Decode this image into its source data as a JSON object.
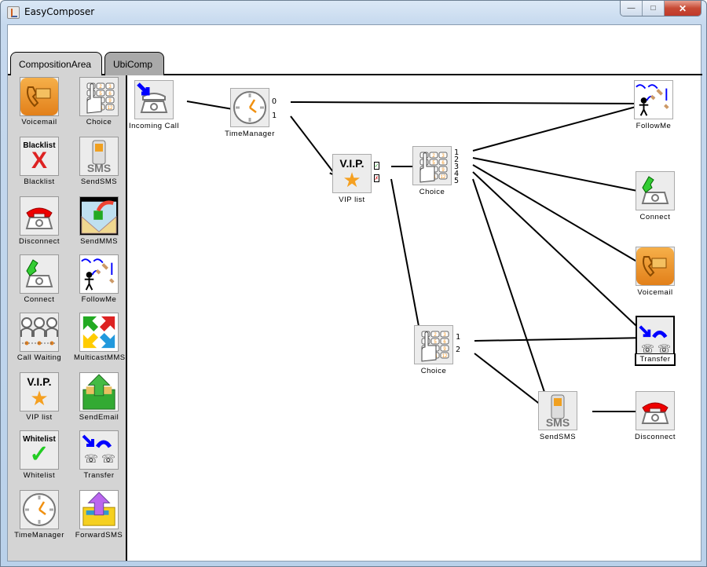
{
  "window": {
    "title": "EasyComposer",
    "controls": {
      "minimize": "—",
      "maximize": "□",
      "close": "✕"
    }
  },
  "tabs": [
    {
      "label": "CompositionArea",
      "active": true
    },
    {
      "label": "UbiComp",
      "active": false
    }
  ],
  "palette": {
    "items": [
      {
        "label": "Voicemail",
        "icon": "voicemail-icon"
      },
      {
        "label": "Choice",
        "icon": "keypad-icon"
      },
      {
        "label": "Blacklist",
        "icon": "blacklist-icon",
        "icon_text": "Blacklist"
      },
      {
        "label": "SendSMS",
        "icon": "sms-phone-icon",
        "icon_text": "SMS"
      },
      {
        "label": "Disconnect",
        "icon": "disconnect-phone-icon"
      },
      {
        "label": "SendMMS",
        "icon": "envelope-mms-icon"
      },
      {
        "label": "Connect",
        "icon": "connect-phone-icon"
      },
      {
        "label": "FollowMe",
        "icon": "followme-icon"
      },
      {
        "label": "Call Waiting",
        "icon": "call-waiting-icon"
      },
      {
        "label": "MulticastMMS",
        "icon": "multicast-arrows-icon"
      },
      {
        "label": "VIP list",
        "icon": "vip-star-icon",
        "icon_text": "V.I.P."
      },
      {
        "label": "SendEmail",
        "icon": "send-email-icon"
      },
      {
        "label": "Whitelist",
        "icon": "whitelist-check-icon",
        "icon_text": "Whitelist"
      },
      {
        "label": "Transfer",
        "icon": "transfer-icon"
      },
      {
        "label": "TimeManager",
        "icon": "clock-icon"
      },
      {
        "label": "ForwardSMS",
        "icon": "forward-sms-icon"
      }
    ]
  },
  "canvas": {
    "nodes": [
      {
        "id": "incoming",
        "label": "Incoming Call",
        "icon": "incoming-call-icon"
      },
      {
        "id": "time",
        "label": "TimeManager",
        "icon": "clock-icon",
        "ports": [
          "O",
          "1"
        ]
      },
      {
        "id": "vip",
        "label": "VIP list",
        "icon": "vip-star-icon",
        "icon_text": "V.I.P.",
        "ports": [
          "✓",
          "✗"
        ]
      },
      {
        "id": "choice1",
        "label": "Choice",
        "icon": "keypad-icon",
        "ports": [
          "1",
          "2",
          "3",
          "4",
          "5"
        ]
      },
      {
        "id": "choice2",
        "label": "Choice",
        "icon": "keypad-icon",
        "ports": [
          "1",
          "2"
        ]
      },
      {
        "id": "followme",
        "label": "FollowMe",
        "icon": "followme-icon"
      },
      {
        "id": "connect",
        "label": "Connect",
        "icon": "connect-phone-icon"
      },
      {
        "id": "voicemail",
        "label": "Voicemail",
        "icon": "voicemail-icon"
      },
      {
        "id": "transfer",
        "label": "Transfer",
        "icon": "transfer-icon",
        "selected": true
      },
      {
        "id": "sendsms",
        "label": "SendSMS",
        "icon": "sms-phone-icon",
        "icon_text": "SMS"
      },
      {
        "id": "disconnect",
        "label": "Disconnect",
        "icon": "disconnect-phone-icon"
      }
    ],
    "connections": [
      {
        "from": "incoming",
        "to": "time"
      },
      {
        "from": "time",
        "port": "O",
        "to": "followme"
      },
      {
        "from": "time",
        "port": "1",
        "to": "vip"
      },
      {
        "from": "vip",
        "port": "✓",
        "to": "choice1"
      },
      {
        "from": "vip",
        "port": "✗",
        "to": "choice2"
      },
      {
        "from": "choice1",
        "port": "1",
        "to": "followme"
      },
      {
        "from": "choice1",
        "port": "2",
        "to": "connect"
      },
      {
        "from": "choice1",
        "port": "3",
        "to": "voicemail"
      },
      {
        "from": "choice1",
        "port": "4",
        "to": "transfer"
      },
      {
        "from": "choice1",
        "port": "5",
        "to": "sendsms"
      },
      {
        "from": "choice2",
        "port": "1",
        "to": "transfer"
      },
      {
        "from": "choice2",
        "port": "2",
        "to": "sendsms"
      },
      {
        "from": "sendsms",
        "to": "disconnect"
      }
    ]
  }
}
